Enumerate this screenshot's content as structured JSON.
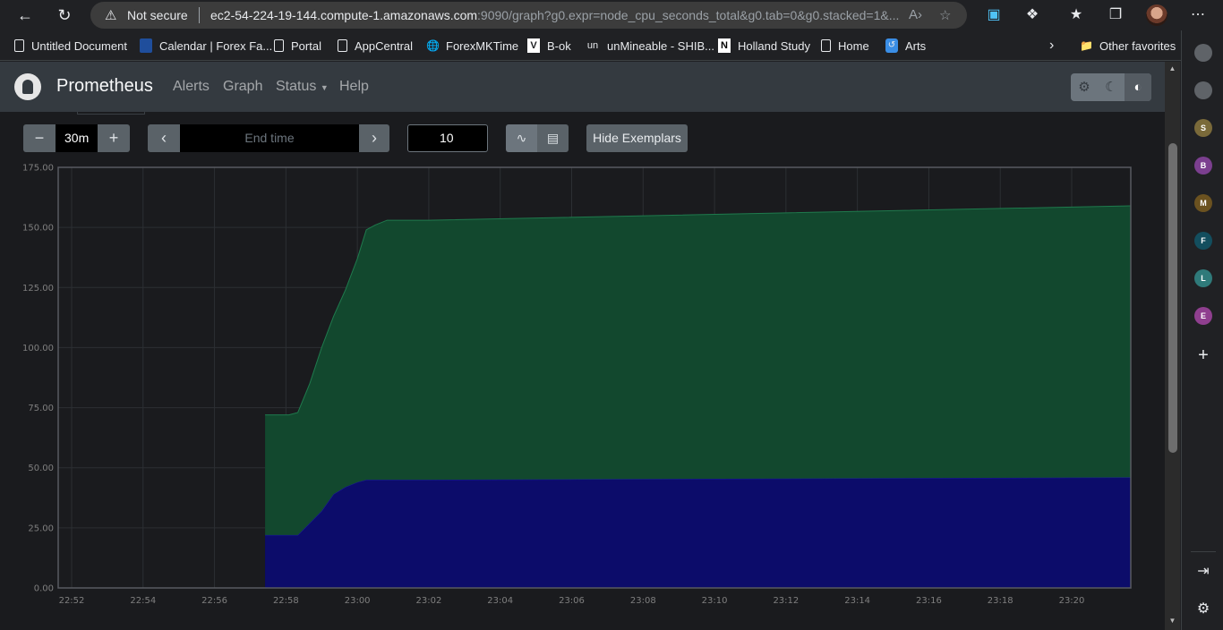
{
  "browser": {
    "address": {
      "not_secure": "Not secure",
      "host": "ec2-54-224-19-144.compute-1.amazonaws.com",
      "path": ":9090/graph?g0.expr=node_cpu_seconds_total&g0.tab=0&g0.stacked=1&..."
    },
    "bookmarks": [
      {
        "label": "Untitled Document",
        "icon": "document-icon"
      },
      {
        "label": "Calendar | Forex Fa...",
        "icon": "calendar-favicon"
      },
      {
        "label": "Portal",
        "icon": "document-icon"
      },
      {
        "label": "AppCentral",
        "icon": "document-icon"
      },
      {
        "label": "ForexMKTime",
        "icon": "globe-icon"
      },
      {
        "label": "B-ok",
        "icon": "v-favicon"
      },
      {
        "label": "unMineable - SHIB...",
        "icon": "un-favicon"
      },
      {
        "label": "Holland Study",
        "icon": "n-favicon"
      },
      {
        "label": "Home",
        "icon": "document-icon"
      },
      {
        "label": "Arts",
        "icon": "arts-favicon"
      }
    ],
    "other_favorites": "Other favorites",
    "sidebar_letters": [
      "S",
      "B",
      "M",
      "F",
      "L",
      "E"
    ]
  },
  "navbar": {
    "brand": "Prometheus",
    "links": [
      "Alerts",
      "Graph",
      "Status",
      "Help"
    ]
  },
  "controls": {
    "minus": "−",
    "range": "30m",
    "plus": "+",
    "end_time_placeholder": "End time",
    "resolution": "10",
    "hide_exemplars": "Hide Exemplars"
  },
  "chart_data": {
    "type": "area",
    "stacked": true,
    "x_ticks": [
      "22:52",
      "22:54",
      "22:56",
      "22:58",
      "23:00",
      "23:02",
      "23:04",
      "23:06",
      "23:08",
      "23:10",
      "23:12",
      "23:14",
      "23:16",
      "23:18",
      "23:20"
    ],
    "y_ticks": [
      "0.00",
      "25.00",
      "50.00",
      "75.00",
      "100.00",
      "125.00",
      "150.00",
      "175.00"
    ],
    "ylim": [
      0,
      175
    ],
    "grid": true,
    "x": [
      "22:57:25",
      "22:58:05",
      "22:58:20",
      "22:58:40",
      "22:59:00",
      "22:59:20",
      "22:59:40",
      "23:00:00",
      "23:00:15",
      "23:00:30",
      "23:00:50",
      "23:02:00",
      "23:21:40"
    ],
    "series": [
      {
        "color": "#0c0c6a",
        "values": [
          22,
          22,
          22,
          27,
          32,
          39,
          42,
          44,
          45,
          45,
          45,
          45,
          46
        ]
      },
      {
        "color": "#12482e",
        "values": [
          50,
          50,
          51,
          58,
          68,
          74,
          82,
          93,
          104,
          106,
          108,
          108,
          113
        ]
      }
    ]
  }
}
